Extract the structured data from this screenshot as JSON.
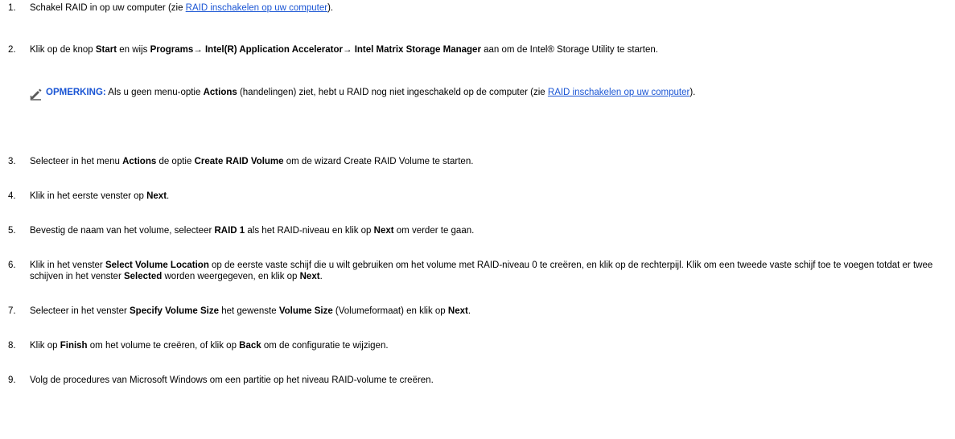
{
  "steps": [
    {
      "num": "1.",
      "parts": [
        "Schakel RAID in op uw computer (zie ",
        "RAID inschakelen op uw computer",
        ")."
      ]
    },
    {
      "num": "2.",
      "parts": [
        "Klik op de knop ",
        "Start",
        " en wijs ",
        "Programs",
        " Intel(R) Application Accelerator",
        " Intel Matrix Storage Manager",
        " aan om de Intel® Storage Utility te starten."
      ],
      "arrow": "→"
    },
    {
      "num": "3.",
      "parts": [
        "Selecteer in het menu ",
        "Actions",
        " de optie ",
        "Create RAID Volume",
        " om de wizard Create RAID Volume te starten."
      ]
    },
    {
      "num": "4.",
      "parts": [
        "Klik in het eerste venster op ",
        "Next",
        "."
      ]
    },
    {
      "num": "5.",
      "parts": [
        "Bevestig de naam van het volume, selecteer ",
        "RAID 1",
        " als het RAID-niveau en klik op ",
        "Next",
        " om verder te gaan."
      ]
    },
    {
      "num": "6.",
      "parts": [
        "Klik in het venster ",
        "Select Volume Location",
        " op de eerste vaste schijf die u wilt gebruiken om het volume met RAID-niveau 0 te creëren, en klik op de rechterpijl. Klik om een tweede vaste schijf toe te voegen totdat er twee schijven in het venster ",
        "Selected",
        " worden weergegeven, en klik op ",
        "Next",
        "."
      ]
    },
    {
      "num": "7.",
      "parts": [
        "Selecteer in het venster ",
        "Specify Volume Size",
        " het gewenste ",
        "Volume Size",
        " (Volumeformaat) en klik op ",
        "Next",
        "."
      ]
    },
    {
      "num": "8.",
      "parts": [
        "Klik op ",
        "Finish",
        " om het volume te creëren, of klik op ",
        "Back",
        " om de configuratie te wijzigen."
      ]
    },
    {
      "num": "9.",
      "parts": [
        "Volg de procedures van Microsoft Windows om een partitie op het niveau RAID-volume te creëren."
      ]
    }
  ],
  "note": {
    "label": "OPMERKING:",
    "parts": [
      " Als u geen menu-optie ",
      "Actions",
      " (handelingen) ziet, hebt u RAID nog niet ingeschakeld op de computer (zie ",
      "RAID inschakelen op uw computer",
      ")."
    ],
    "icon": "pencil-note-icon"
  }
}
